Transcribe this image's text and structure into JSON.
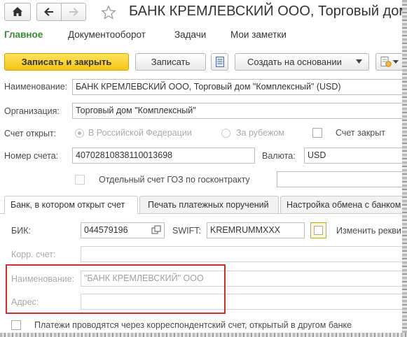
{
  "window": {
    "title": "БАНК КРЕМЛЕВСКИЙ ООО, Торговый дом \"Комплексный\" (USD)"
  },
  "nav": {
    "home_icon": "home-icon",
    "back_icon": "arrow-left-icon",
    "forward_icon": "arrow-right-icon",
    "favorite_icon": "star-icon"
  },
  "menu": {
    "items": [
      {
        "label": "Главное",
        "active": true
      },
      {
        "label": "Документооборот"
      },
      {
        "label": "Задачи"
      },
      {
        "label": "Мои заметки"
      }
    ]
  },
  "toolbar": {
    "save_close_label": "Записать и закрыть",
    "save_label": "Записать",
    "list_icon": "list-icon",
    "create_based_label": "Создать на основании",
    "dropdown_icon": "triangle-down-icon",
    "report_icon": "report-icon"
  },
  "form": {
    "name_label": "Наименование:",
    "name_value": "БАНК КРЕМЛЕВСКИЙ ООО, Торговый дом \"Комплексный\" (USD)",
    "org_label": "Организация:",
    "org_value": "Торговый дом \"Комплексный\"",
    "opened_label": "Счет открыт:",
    "opened_options": [
      "В Российской Федерации",
      "За рубежом"
    ],
    "account_closed_label": "Счет закрыт",
    "account_number_label": "Номер счета:",
    "account_number_value": "40702810838110013698",
    "currency_label": "Валюта:",
    "currency_value": "USD",
    "goz_label": "Отдельный счет ГОЗ по госконтракту"
  },
  "tabs": [
    {
      "label": "Банк, в котором открыт счет",
      "active": true
    },
    {
      "label": "Печать платежных поручений"
    },
    {
      "label": "Настройка обмена с банком"
    }
  ],
  "bank": {
    "bik_label": "БИК:",
    "bik_value": "044579196",
    "bik_button_icon": "open-form-icon",
    "swift_label": "SWIFT:",
    "swift_value": "KREMRUMMXXX",
    "change_label": "Изменить рекви",
    "corr_label": "Корр. счет:",
    "corr_value": "",
    "bank_name_label": "Наименование:",
    "bank_name_value": "\"БАНК КРЕМЛЕВСКИЙ\" ООО",
    "address_label": "Адрес:",
    "address_value": "",
    "correspondent_label": "Платежи проводятся через корреспондентский счет, открытый в другом банке"
  },
  "colors": {
    "accent_green": "#3a8a38",
    "primary_button": "#f5c516",
    "highlight_border": "#d32a2a"
  }
}
